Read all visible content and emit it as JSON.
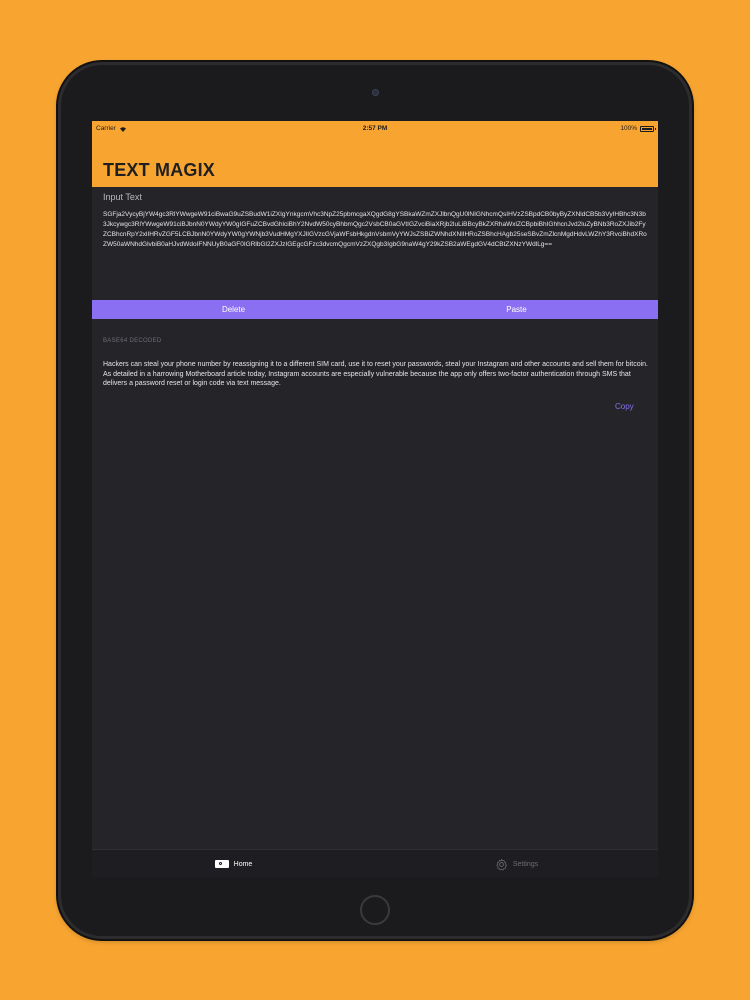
{
  "status_bar": {
    "carrier": "Carrier",
    "time": "2:57 PM",
    "battery": "100%"
  },
  "header": {
    "title": "TEXT MAGIX"
  },
  "input": {
    "label": "Input Text",
    "value": "SGFja2VycyBjYW4gc3RlYWwgeW91ciBwaG9uZSBudW1iZXIgYnkgcmVhc3NpZ25pbmcgaXQgdG8gYSBkaWZmZXJlbnQgU0lNIGNhcmQsIHVzZSBpdCB0byByZXNldCB5b3VyIHBhc3N3b3Jkcywgc3RlYWwgeW91ciBJbnN0YWdyYW0gIGFuZCBvdGhlciBhY2NvdW50cyBhbmQgc2VsbCB0aGVtIGZvciBiaXRjb2luLiBBcyBkZXRhaWxlZCBpbiBhIGhhcnJvd2luZyBNb3RoZXJib2FyZCBhcnRpY2xlIHRvZGF5LCBJbnN0YWdyYW0gYWNjb3VudHMgYXJlIGVzcGVjaWFsbHkgdnVsbmVyYWJsZSBiZWNhdXNlIHRoZSBhcHAgb25seSBvZmZlcnMgdHdvLWZhY3RvciBhdXRoZW50aWNhdGlvbiB0aHJvdWdoIFNNUyB0aGF0IGRlbGl2ZXJzIGEgcGFzc3dvcmQgcmVzZXQgb3IgbG9naW4gY29kZSB2aWEgdGV4dCBtZXNzYWdlLg=="
  },
  "actions": {
    "delete_label": "Delete",
    "paste_label": "Paste"
  },
  "output": {
    "section_label": "BASE64 DECODED",
    "text": "Hackers can steal your phone number by reassigning it to a different SIM card, use it to reset your passwords, steal your Instagram  and other accounts and sell them for bitcoin. As detailed in a harrowing Motherboard article today, Instagram accounts are especially vulnerable because the app only offers two-factor authentication through SMS that delivers a password reset or login code via text message.",
    "copy_label": "Copy"
  },
  "tab_bar": {
    "tabs": [
      {
        "label": "Home",
        "icon": "home-icon"
      },
      {
        "label": "Settings",
        "icon": "gear-icon"
      }
    ]
  },
  "colors": {
    "background": "#f7a431",
    "header": "#f7a431",
    "screen": "#242429",
    "accent": "#8a6ff2"
  }
}
